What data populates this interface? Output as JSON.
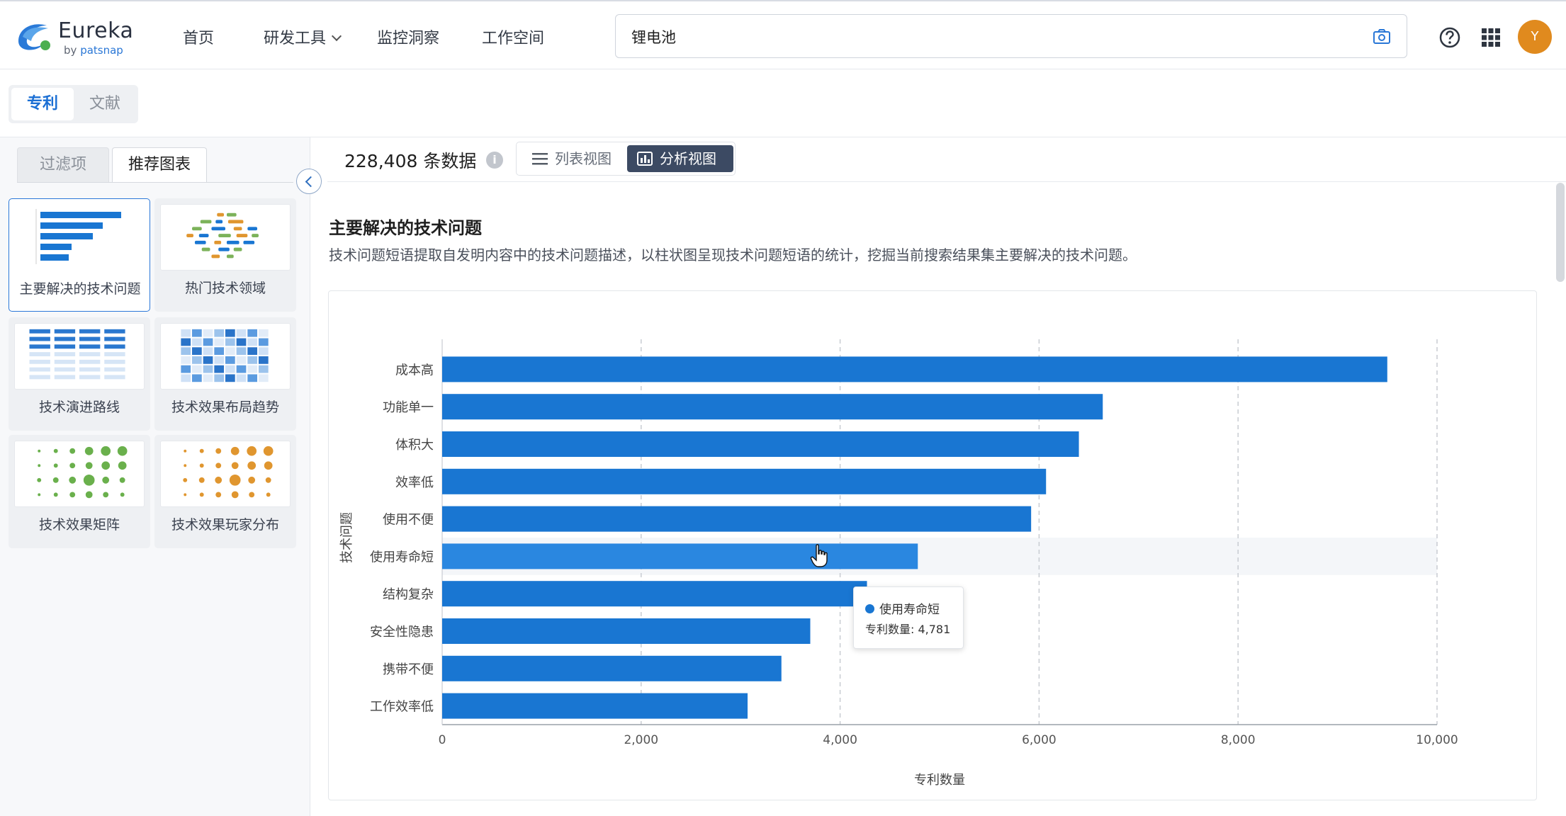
{
  "header": {
    "logo_text": "Eureka",
    "logo_sub_prefix": "by",
    "logo_sub_brand": "patsnap",
    "nav": [
      "首页",
      "研发工具",
      "监控洞察",
      "工作空间"
    ],
    "search_value": "锂电池",
    "avatar_letter": "Y",
    "icons": {
      "camera": "camera-icon",
      "help": "help-icon",
      "apps": "apps-grid-icon"
    }
  },
  "type_tabs": {
    "active": "专利",
    "inactive": "文献"
  },
  "sidebar": {
    "tabs": [
      "过滤项",
      "推荐图表"
    ],
    "cards": [
      {
        "label": "主要解决的技术问题",
        "active": true,
        "thumb": "bar-thumb"
      },
      {
        "label": "热门技术领域",
        "active": false,
        "thumb": "wordcloud-thumb"
      },
      {
        "label": "技术演进路线",
        "active": false,
        "thumb": "table-thumb"
      },
      {
        "label": "技术效果布局趋势",
        "active": false,
        "thumb": "heatmap-thumb"
      },
      {
        "label": "技术效果矩阵",
        "active": false,
        "thumb": "bubble-green-thumb"
      },
      {
        "label": "技术效果玩家分布",
        "active": false,
        "thumb": "bubble-orange-thumb"
      }
    ]
  },
  "main": {
    "count_value": "228,408",
    "count_unit": "条数据",
    "view_list": "列表视图",
    "view_analysis": "分析视图",
    "section_title": "主要解决的技术问题",
    "section_desc": "技术问题短语提取自发明内容中的技术问题描述，以柱状图呈现技术问题短语的统计，挖掘当前搜索结果集主要解决的技术问题。"
  },
  "colors": {
    "bar": "#1976d2",
    "bar_hover": "#2a87e0",
    "accent": "#1b6fd4",
    "avatar": "#e08a1e"
  },
  "chart_data": {
    "type": "bar",
    "orientation": "horizontal",
    "categories": [
      "成本高",
      "功能单一",
      "体积大",
      "效率低",
      "使用不便",
      "使用寿命短",
      "结构复杂",
      "安全性隐患",
      "携带不便",
      "工作效率低"
    ],
    "values": [
      9500,
      6640,
      6400,
      6070,
      5920,
      4781,
      4270,
      3700,
      3410,
      3070
    ],
    "xlabel": "专利数量",
    "ylabel": "技术问题",
    "xlim": [
      0,
      10000
    ],
    "xticks": [
      "0",
      "2,000",
      "4,000",
      "6,000",
      "8,000",
      "10,000"
    ],
    "grid": "vertical dashed",
    "highlighted": "使用寿命短",
    "tooltip": {
      "name": "使用寿命短",
      "label": "专利数量: 4,781"
    }
  }
}
